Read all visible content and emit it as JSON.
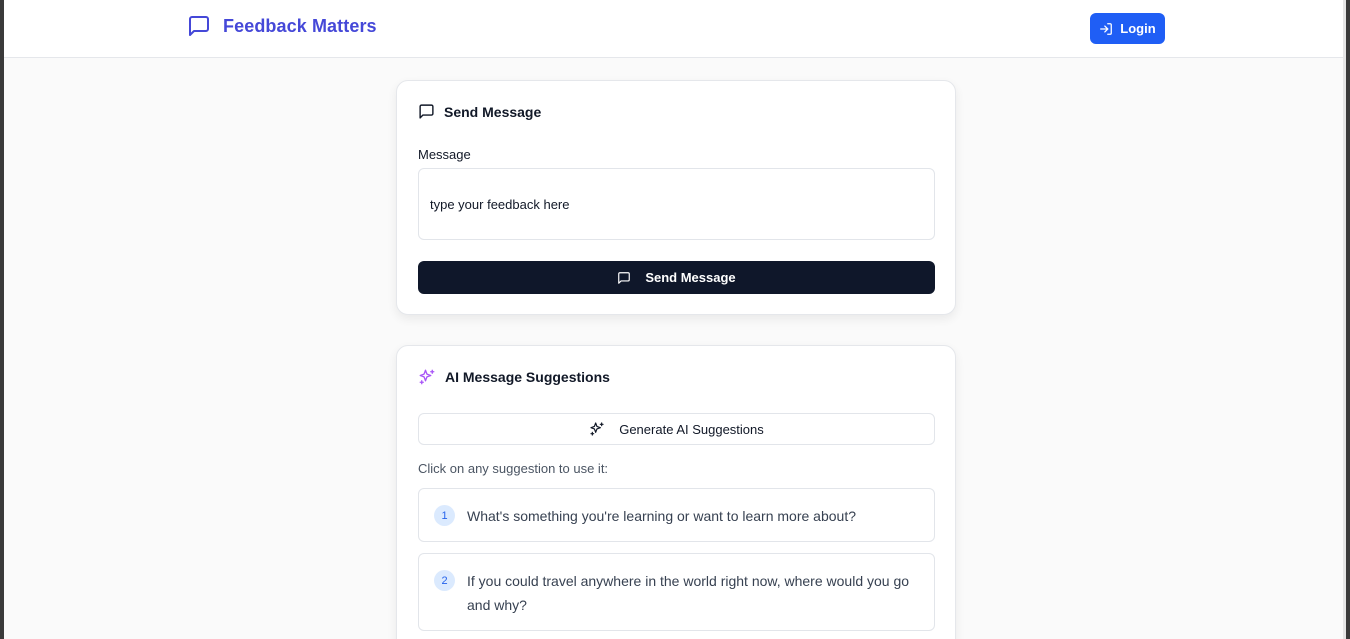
{
  "header": {
    "brand_icon": "message-square-icon",
    "brand_title": "Feedback Matters",
    "login_label": "Login",
    "login_icon": "log-in-icon",
    "brand_color": "#4548d8",
    "login_color": "#1f5ef5"
  },
  "send_card": {
    "title": "Send Message",
    "title_icon": "message-square-icon",
    "field_label": "Message",
    "input_value": "type your feedback here",
    "button_label": "Send Message",
    "button_icon": "message-square-icon",
    "button_color": "#0f172a"
  },
  "ai_card": {
    "title": "AI Message Suggestions",
    "title_icon": "sparkles-icon",
    "generate_label": "Generate AI Suggestions",
    "generate_icon": "sparkles-icon",
    "hint": "Click on any suggestion to use it:",
    "suggestions": [
      {
        "number": "1",
        "text": "What's something you're learning or want to learn more about?"
      },
      {
        "number": "2",
        "text": "If you could travel anywhere in the world right now, where would you go and why?"
      }
    ],
    "accent_color": "#a855f7"
  }
}
